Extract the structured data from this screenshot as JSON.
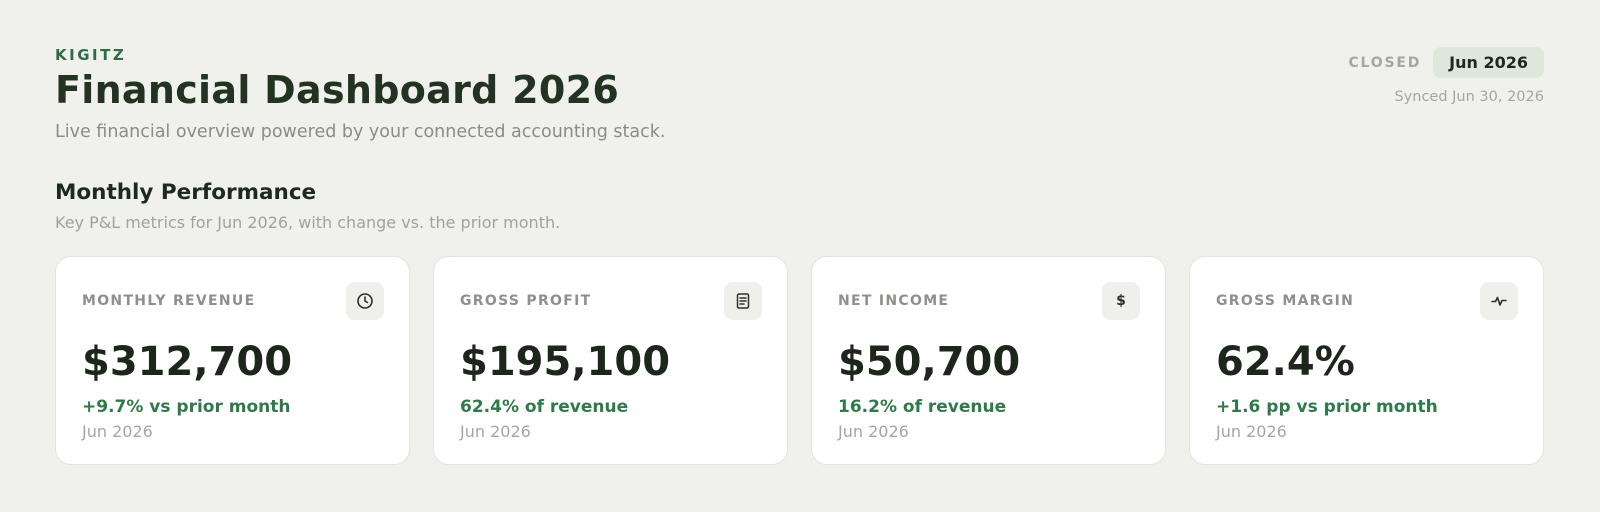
{
  "header": {
    "brand": "KIGITZ",
    "title": "Financial Dashboard 2026",
    "subtitle": "Live financial overview powered by your connected accounting stack.",
    "status_label": "CLOSED",
    "period_badge": "Jun 2026",
    "synced": "Synced Jun 30, 2026"
  },
  "section": {
    "title": "Monthly Performance",
    "subtitle": "Key P&L metrics for Jun 2026, with change vs. the prior month."
  },
  "cards": [
    {
      "label": "MONTHLY REVENUE",
      "value": "$312,700",
      "delta": "+9.7% vs prior month",
      "period": "Jun 2026",
      "icon": "clock-icon"
    },
    {
      "label": "GROSS PROFIT",
      "value": "$195,100",
      "delta": "62.4% of revenue",
      "period": "Jun 2026",
      "icon": "document-icon"
    },
    {
      "label": "NET INCOME",
      "value": "$50,700",
      "delta": "16.2% of revenue",
      "period": "Jun 2026",
      "icon": "dollar-icon",
      "icon_glyph": "$"
    },
    {
      "label": "GROSS MARGIN",
      "value": "62.4%",
      "delta": "+1.6 pp vs prior month",
      "period": "Jun 2026",
      "icon": "activity-icon"
    }
  ],
  "colors": {
    "background": "#f0f1ec",
    "brand": "#2f6b45",
    "positive": "#2f7a4a",
    "badge": "#dfe7dc"
  }
}
